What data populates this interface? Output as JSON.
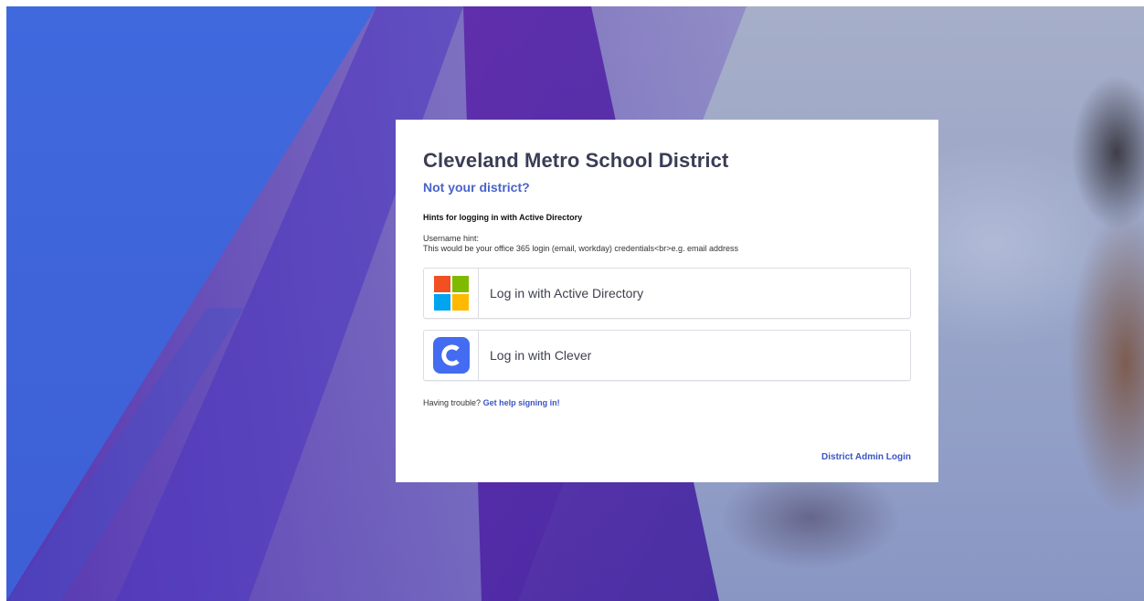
{
  "card": {
    "district_name": "Cleveland Metro School District",
    "not_your_district": "Not your district?",
    "hints_title": "Hints for logging in with Active Directory",
    "username_hint_label": "Username hint:",
    "username_hint_text": "This would be your office 365 login (email, workday) credentials<br>e.g. email address"
  },
  "login_options": [
    {
      "label": "Log in with Active Directory",
      "icon": "microsoft-logo-icon"
    },
    {
      "label": "Log in with Clever",
      "icon": "clever-logo-icon"
    }
  ],
  "help": {
    "prefix": "Having trouble?",
    "link": "Get help signing in!"
  },
  "admin_login": "District Admin Login",
  "colors": {
    "background_blue": "#3f6ad8",
    "background_purple": "#4a1fa0",
    "link_blue": "#3b56c4",
    "title_color": "#3b3d55",
    "ms_red": "#f25022",
    "ms_green": "#7fba00",
    "ms_blue": "#00a4ef",
    "ms_yellow": "#ffb900",
    "clever_blue": "#436cf2"
  }
}
